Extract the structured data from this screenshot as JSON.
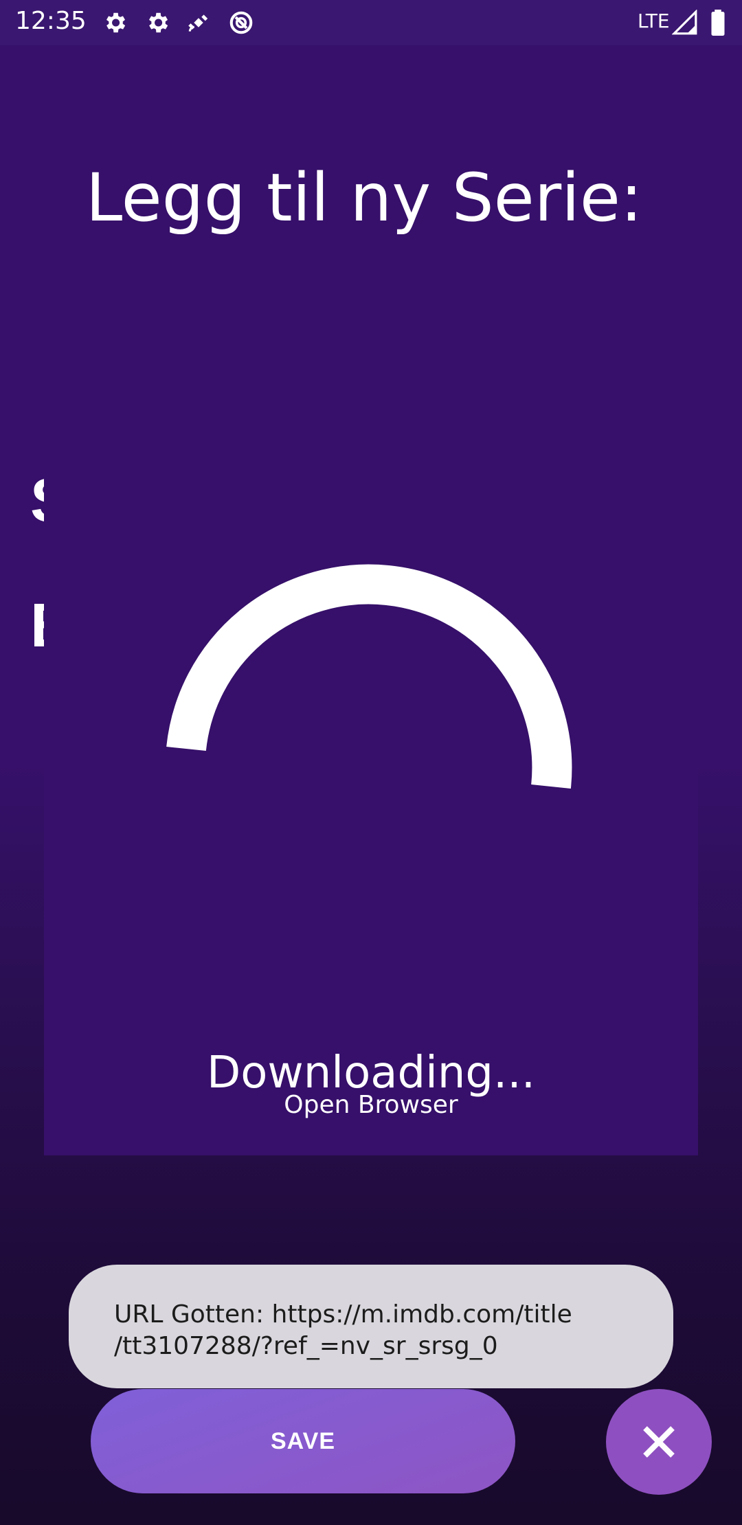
{
  "status_bar": {
    "time": "12:35",
    "network": "LTE",
    "icons": [
      "gear-icon",
      "gear-icon",
      "satellite-icon",
      "do-not-disturb-icon",
      "signal-icon",
      "battery-icon"
    ]
  },
  "page": {
    "title": "Legg til ny Serie:",
    "obscured_labels": [
      "S",
      "E"
    ]
  },
  "dialog": {
    "status": "Downloading...",
    "link_label": "Open Browser",
    "progress_indicator": "spinner"
  },
  "toast": {
    "message": "URL Gotten: https://m.imdb.com/title\n/tt3107288/?ref_=nv_sr_srsg_0"
  },
  "actions": {
    "save_label": "SAVE",
    "close_icon": "close-icon"
  },
  "colors": {
    "background": "#36106a",
    "accent": "#8e50c0",
    "toast": "#d9d7dd"
  }
}
